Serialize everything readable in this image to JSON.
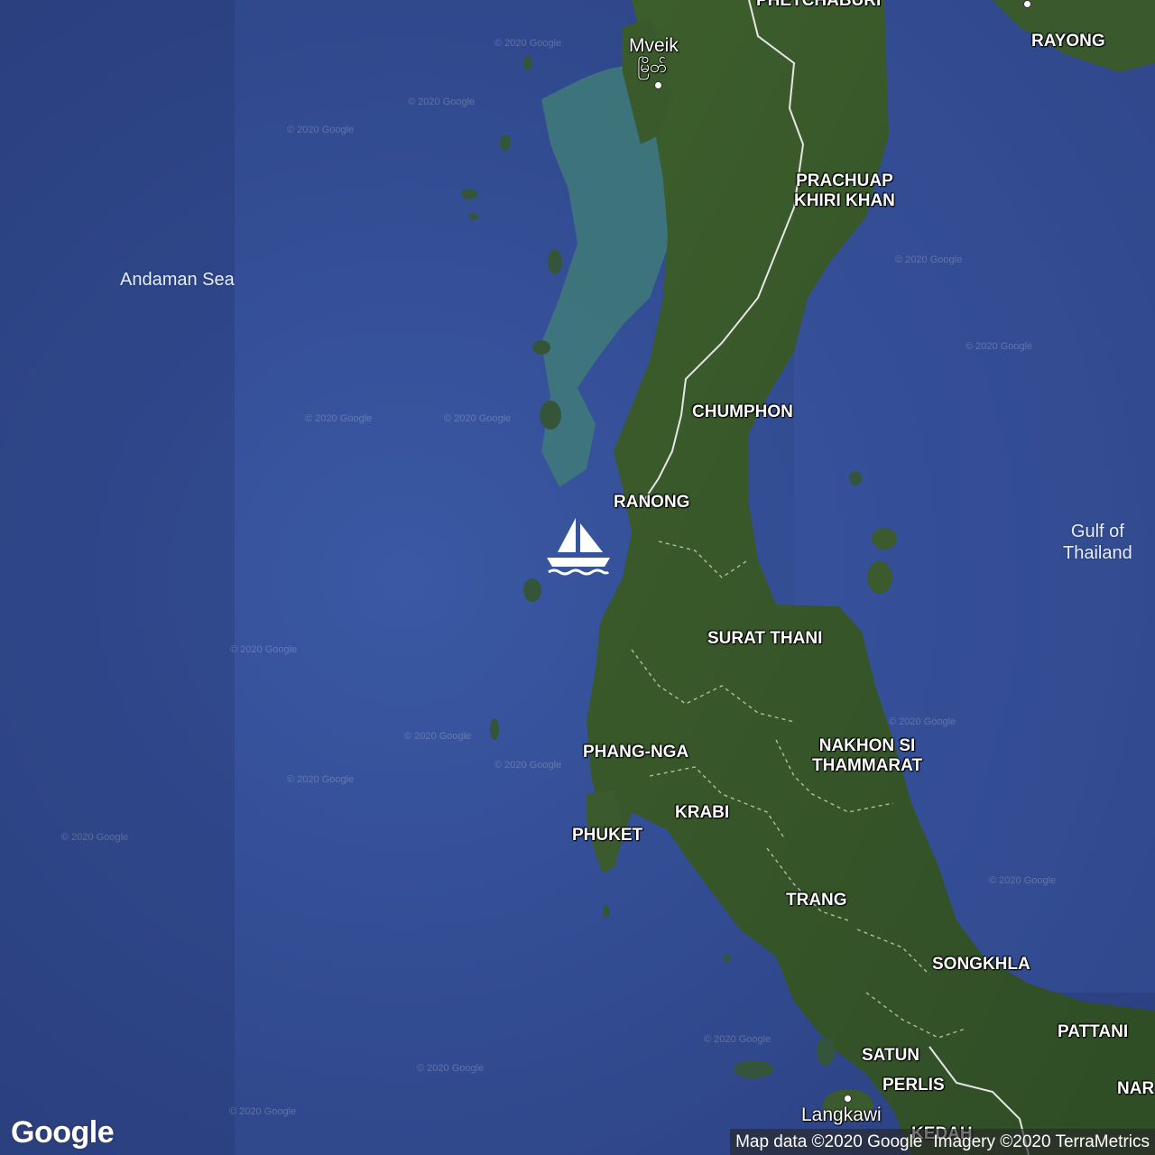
{
  "map": {
    "water_labels": {
      "andaman_sea": "Andaman Sea",
      "gulf_line1": "Gulf of",
      "gulf_line2": "Thailand"
    },
    "cities": {
      "mveik": "Mveik",
      "mveik_native": "မြိတ်",
      "langkawi": "Langkawi"
    },
    "provinces": {
      "phetchaburi": "PHETCHABURI",
      "rayong": "RAYONG",
      "prachuap_line1": "PRACHUAP",
      "prachuap_line2": "KHIRI KHAN",
      "chumphon": "CHUMPHON",
      "ranong": "RANONG",
      "surat_thani": "SURAT THANI",
      "phang_nga": "PHANG-NGA",
      "nakhon_line1": "NAKHON SI",
      "nakhon_line2": "THAMMARAT",
      "krabi": "KRABI",
      "phuket": "PHUKET",
      "trang": "TRANG",
      "songkhla": "SONGKHLA",
      "pattani": "PATTANI",
      "satun": "SATUN",
      "perlis": "PERLIS",
      "kedah": "KEDAH",
      "nar": "NAR"
    },
    "watermark": "© 2020 Google",
    "marker_icon": "sailboat-icon"
  },
  "footer": {
    "logo": "Google",
    "map_data": "Map data ©2020 Google",
    "imagery": "Imagery ©2020 TerraMetrics"
  },
  "colors": {
    "sea": "#2f4a8e",
    "land": "#3a5a2e",
    "shallow": "#3f7a78"
  }
}
